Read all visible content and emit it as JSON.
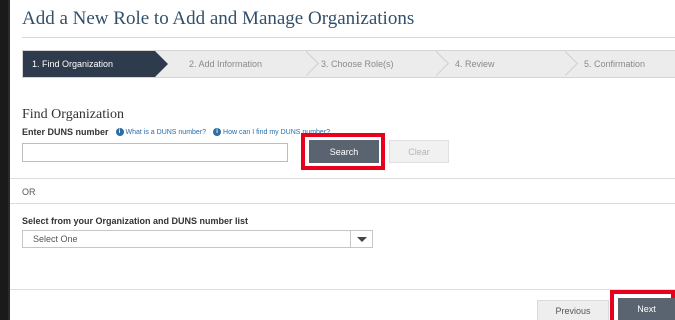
{
  "page": {
    "title": "Add a New Role to Add and Manage Organizations"
  },
  "steps": [
    {
      "label": "1. Find Organization",
      "active": true
    },
    {
      "label": "2. Add Information"
    },
    {
      "label": "3. Choose Role(s)"
    },
    {
      "label": "4. Review"
    },
    {
      "label": "5. Confirmation"
    }
  ],
  "find_org": {
    "title": "Find Organization",
    "duns_label": "Enter DUNS number",
    "help_links": [
      "What is a DUNS number?",
      "How can I find my DUNS number?"
    ],
    "duns_value": "",
    "search_label": "Search",
    "clear_label": "Clear"
  },
  "or_text": "OR",
  "select_section": {
    "label": "Select from your Organization and DUNS number list",
    "selected": "Select One"
  },
  "footer": {
    "previous_label": "Previous",
    "next_label": "Next"
  },
  "colors": {
    "active_step": "#2e3b4d",
    "highlight": "#e8001c",
    "primary_button": "#5a6370",
    "link": "#2a6ea8"
  }
}
